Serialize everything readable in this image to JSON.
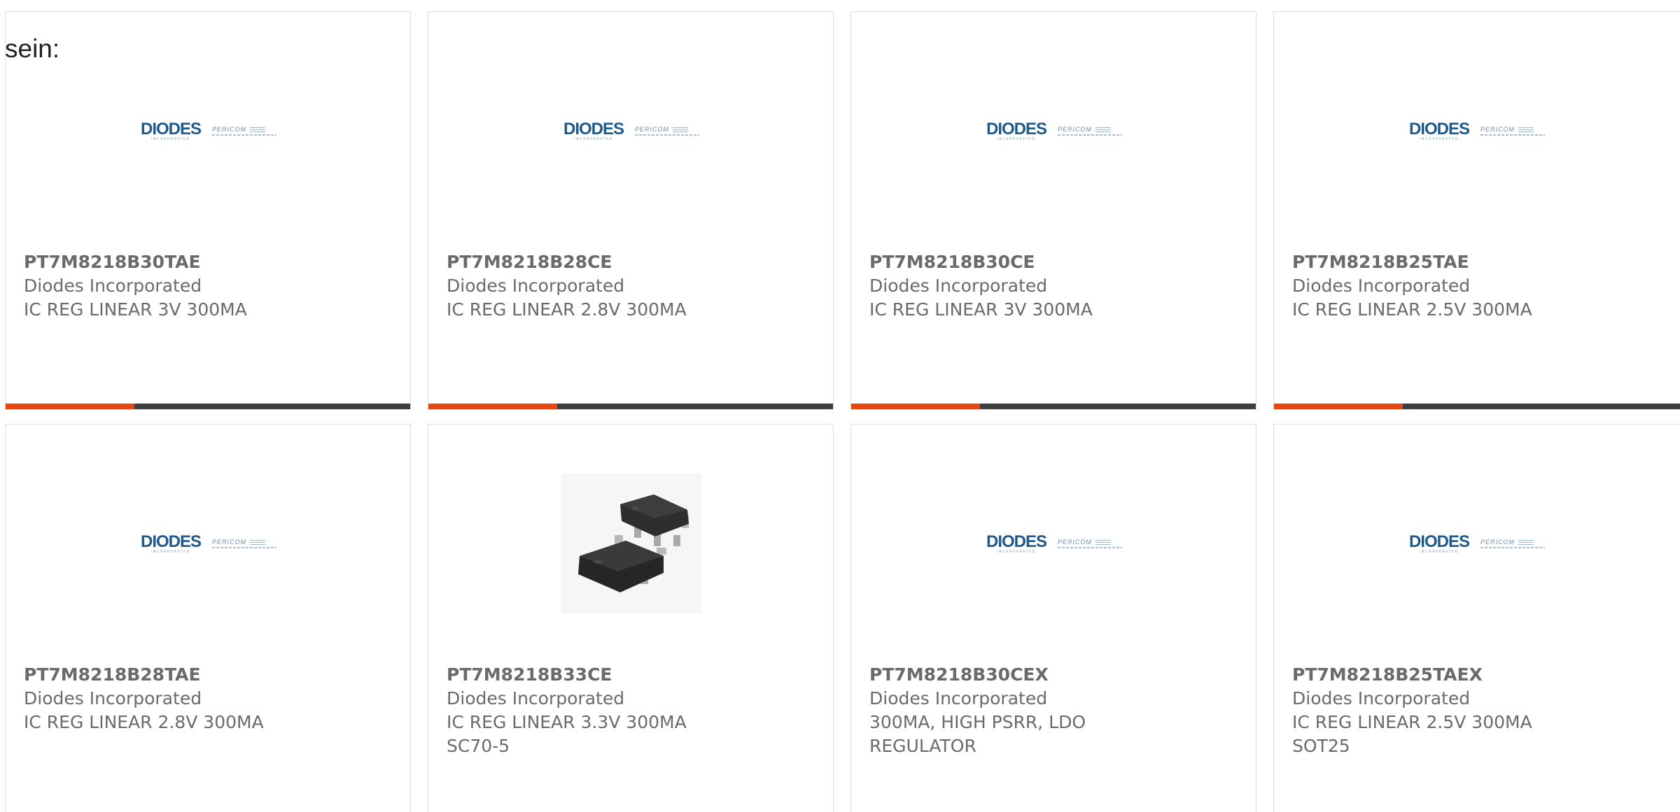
{
  "intro_text": "sein:",
  "colors": {
    "accent": "#e84511",
    "bar": "#3f3f3f",
    "text": "#6a6a6a",
    "brand_blue": "#1d5a8e"
  },
  "logo": {
    "diodes": "DIODES",
    "diodes_sub": "INCORPORATED",
    "pericom": "PERICOM"
  },
  "products": [
    {
      "part": "PT7M8218B30TAE",
      "manufacturer": "Diodes Incorporated",
      "desc": "IC REG LINEAR 3V 300MA",
      "image": "diodes-pericom-logo"
    },
    {
      "part": "PT7M8218B28CE",
      "manufacturer": "Diodes Incorporated",
      "desc": "IC REG LINEAR 2.8V 300MA",
      "image": "diodes-pericom-logo"
    },
    {
      "part": "PT7M8218B30CE",
      "manufacturer": "Diodes Incorporated",
      "desc": "IC REG LINEAR 3V 300MA",
      "image": "diodes-pericom-logo"
    },
    {
      "part": "PT7M8218B25TAE",
      "manufacturer": "Diodes Incorporated",
      "desc": "IC REG LINEAR 2.5V 300MA",
      "image": "diodes-pericom-logo"
    },
    {
      "part": "PT7M8218B28TAE",
      "manufacturer": "Diodes Incorporated",
      "desc": "IC REG LINEAR 2.8V 300MA",
      "image": "diodes-pericom-logo"
    },
    {
      "part": "PT7M8218B33CE",
      "manufacturer": "Diodes Incorporated",
      "desc": "IC REG LINEAR 3.3V 300MA\nSC70-5",
      "image": "sc70-5-package-photo"
    },
    {
      "part": "PT7M8218B30CEX",
      "manufacturer": "Diodes Incorporated",
      "desc": "300MA, HIGH PSRR, LDO\nREGULATOR",
      "image": "diodes-pericom-logo"
    },
    {
      "part": "PT7M8218B25TAEX",
      "manufacturer": "Diodes Incorporated",
      "desc": "IC REG LINEAR 2.5V 300MA\nSOT25",
      "image": "diodes-pericom-logo"
    }
  ]
}
